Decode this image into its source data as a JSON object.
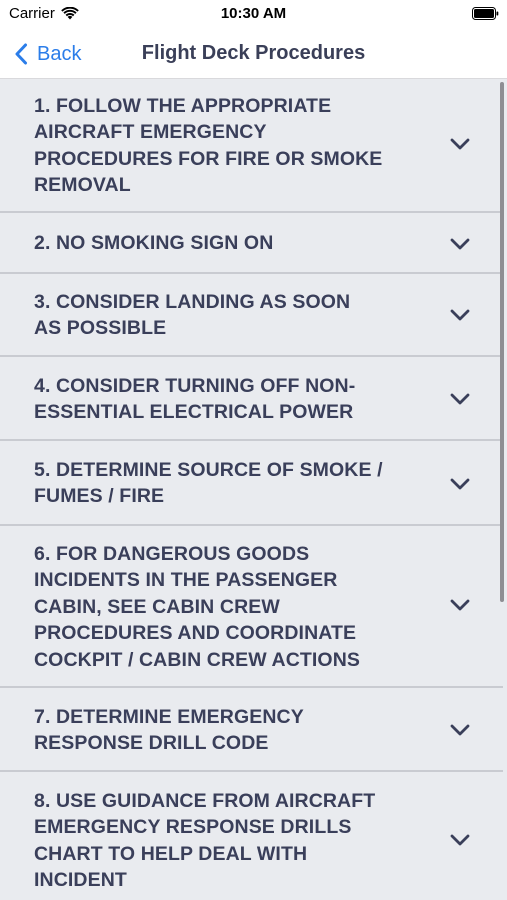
{
  "status_bar": {
    "carrier": "Carrier",
    "time": "10:30 AM",
    "icons": [
      "wifi-icon",
      "battery-icon"
    ]
  },
  "nav": {
    "back_label": "Back",
    "title": "Flight Deck Procedures",
    "accent_color": "#2b7de9"
  },
  "procedures": [
    {
      "lines": [
        "1. FOLLOW THE APPROPRIATE",
        "AIRCRAFT EMERGENCY",
        "PROCEDURES FOR FIRE OR SMOKE",
        "REMOVAL"
      ],
      "icon": "chevron-down-icon",
      "expanded": false
    },
    {
      "lines": [
        "2. NO SMOKING SIGN ON"
      ],
      "icon": "chevron-down-icon",
      "expanded": false
    },
    {
      "lines": [
        "3. CONSIDER LANDING AS SOON",
        "AS POSSIBLE"
      ],
      "icon": "chevron-down-icon",
      "expanded": false
    },
    {
      "lines": [
        "4. CONSIDER TURNING OFF NON-",
        "ESSENTIAL ELECTRICAL POWER"
      ],
      "icon": "chevron-down-icon",
      "expanded": false
    },
    {
      "lines": [
        "5. DETERMINE SOURCE OF SMOKE /",
        "FUMES / FIRE"
      ],
      "icon": "chevron-down-icon",
      "expanded": false
    },
    {
      "lines": [
        "6. FOR DANGEROUS GOODS",
        "INCIDENTS IN THE PASSENGER",
        "CABIN, SEE CABIN CREW",
        "PROCEDURES AND COORDINATE",
        "COCKPIT / CABIN CREW ACTIONS"
      ],
      "icon": "chevron-down-icon",
      "expanded": false
    },
    {
      "lines": [
        "7. DETERMINE EMERGENCY",
        "RESPONSE DRILL CODE"
      ],
      "icon": "chevron-down-icon",
      "expanded": false
    },
    {
      "lines": [
        "8. USE GUIDANCE FROM AIRCRAFT",
        "EMERGENCY RESPONSE DRILLS",
        "CHART TO HELP DEAL WITH",
        "INCIDENT"
      ],
      "icon": "chevron-down-icon",
      "expanded": false
    }
  ]
}
